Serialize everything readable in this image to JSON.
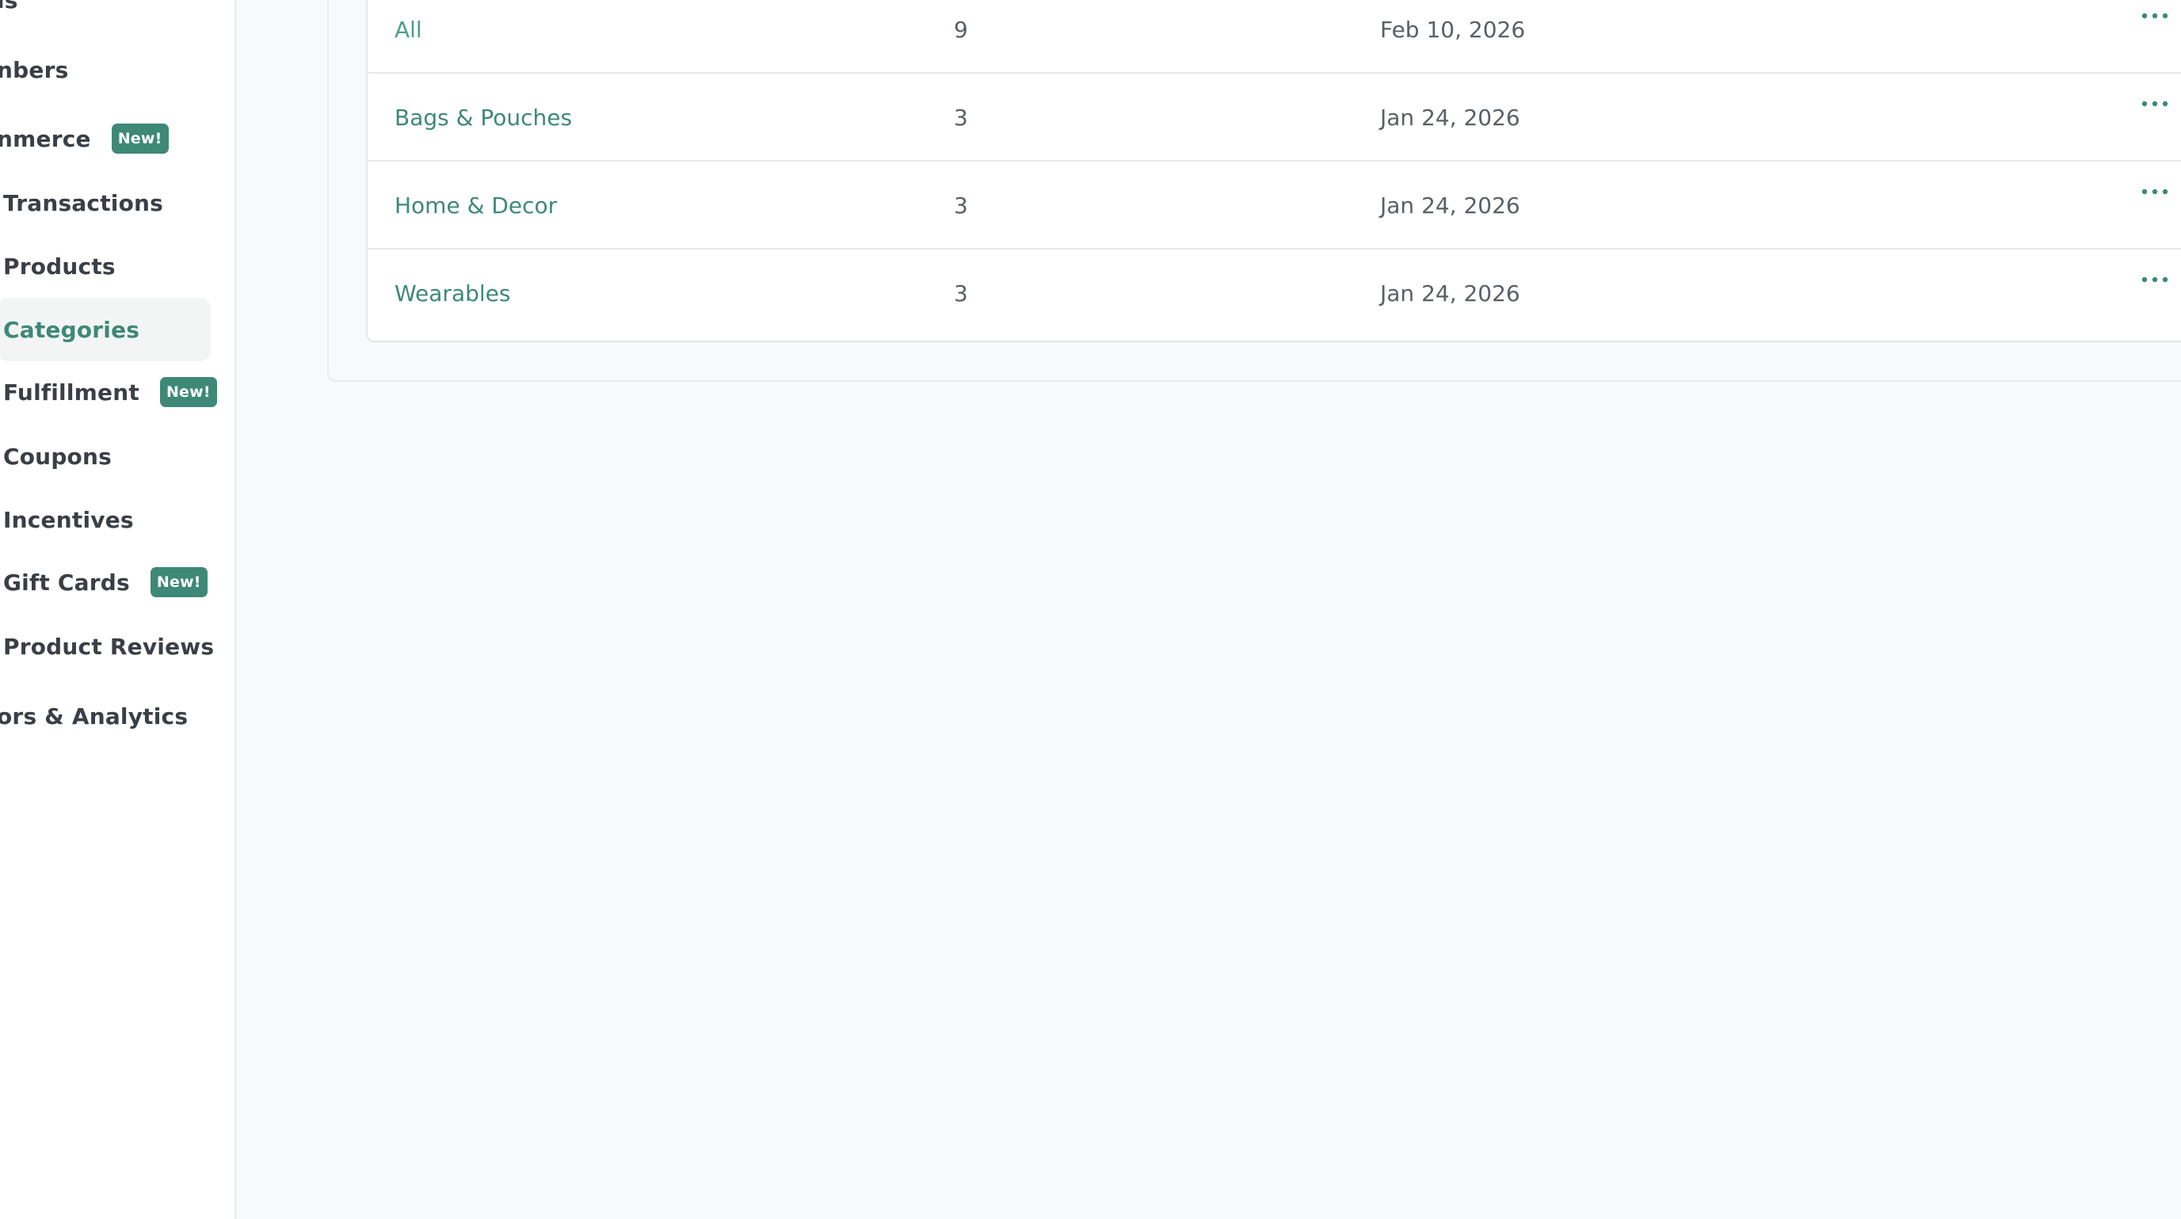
{
  "sidebar": {
    "items": [
      {
        "label": "ls"
      },
      {
        "label": "nbers"
      },
      {
        "label": "nmerce",
        "badge": "New!"
      },
      {
        "label": "Transactions"
      },
      {
        "label": "Products"
      },
      {
        "label": "Categories",
        "active": true
      },
      {
        "label": "Fulfillment",
        "badge": "New!"
      },
      {
        "label": "Coupons"
      },
      {
        "label": "Incentives"
      },
      {
        "label": "Gift Cards",
        "badge": "New!"
      },
      {
        "label": "Product Reviews"
      },
      {
        "label": "ors & Analytics"
      }
    ]
  },
  "table": {
    "rows": [
      {
        "name": "All",
        "count": "9",
        "date": "Feb 10, 2026"
      },
      {
        "name": "Bags & Pouches",
        "count": "3",
        "date": "Jan 24, 2026"
      },
      {
        "name": "Home & Decor",
        "count": "3",
        "date": "Jan 24, 2026"
      },
      {
        "name": "Wearables",
        "count": "3",
        "date": "Jan 24, 2026"
      }
    ]
  },
  "colors": {
    "accent": "#3e8877",
    "page_background": "#f8f9fa",
    "sidebar_background": "#ffffff",
    "text": "#3a3f47"
  },
  "icons": {
    "row_actions": "more-horizontal-icon"
  }
}
